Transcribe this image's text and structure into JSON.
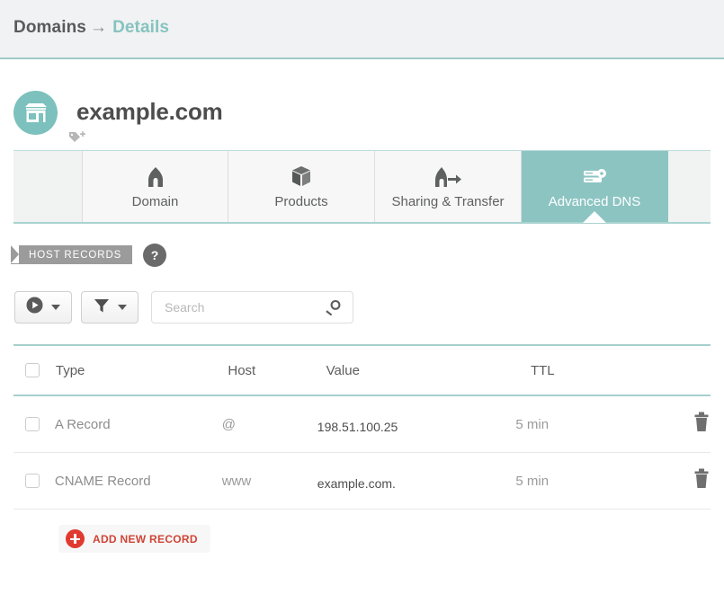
{
  "breadcrumb": {
    "root": "Domains",
    "arrow": "→",
    "current": "Details"
  },
  "domain": {
    "name": "example.com",
    "avatar_icon": "storefront-icon",
    "tag_icon": "add-tag-icon",
    "avatar_color": "#7cc1bd"
  },
  "tabs": [
    {
      "label": "Domain",
      "icon": "home-icon",
      "active": false
    },
    {
      "label": "Products",
      "icon": "box-icon",
      "active": false
    },
    {
      "label": "Sharing & Transfer",
      "icon": "house-arrow-icon",
      "active": false
    },
    {
      "label": "Advanced DNS",
      "icon": "server-gear-icon",
      "active": true
    }
  ],
  "section": {
    "badge": "HOST RECORDS",
    "badge_color": "#9b9b9b",
    "help_label": "?"
  },
  "toolbar": {
    "action_button_icon": "play-circle-icon",
    "filter_button_icon": "funnel-icon",
    "search": {
      "value": "",
      "placeholder": "Search",
      "icon": "search-icon"
    }
  },
  "table": {
    "columns": [
      "Type",
      "Host",
      "Value",
      "TTL"
    ],
    "rows": [
      {
        "type": "A Record",
        "host": "@",
        "value": "198.51.100.25",
        "ttl": "5 min",
        "delete_icon": "trash-icon"
      },
      {
        "type": "CNAME Record",
        "host": "www",
        "value": "example.com.",
        "ttl": "5 min",
        "delete_icon": "trash-icon"
      }
    ]
  },
  "add_record": {
    "label": "ADD NEW RECORD",
    "icon": "plus-circle-icon",
    "accent_color": "#cf4436"
  },
  "theme": {
    "accent_teal": "#86c3bf",
    "header_bg": "#f1f2f3"
  }
}
